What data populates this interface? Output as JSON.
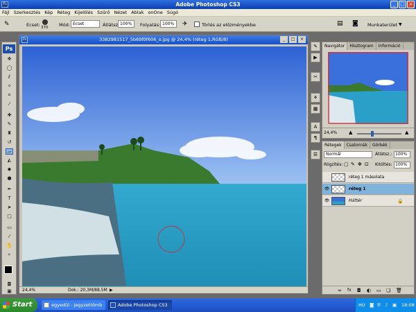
{
  "titlebar": {
    "title": "Adobe Photoshop CS3",
    "app_badge": "Ps"
  },
  "menu": [
    "Fájl",
    "Szerkesztés",
    "Kép",
    "Réteg",
    "Kijelölés",
    "Szűrő",
    "Nézet",
    "Ablak",
    "onOne",
    "Súgó"
  ],
  "options": {
    "brush_label": "Ecset:",
    "brush_size": "370",
    "mode_label": "Mód:",
    "mode_value": "Ecset",
    "opacity_label": "Átlátsz.:",
    "opacity_value": "100%",
    "flow_label": "Folyatás:",
    "flow_value": "100%",
    "erase_history_label": "Törlés az előzményekbe",
    "workspace_label": "Munkaterület"
  },
  "toolbox": {
    "logo": "Ps"
  },
  "document": {
    "title": "3382981517_5b69f0f606_o.jpg @ 24,4% (réteg 1,RGB/8)",
    "zoom": "24,4%",
    "doc_size": "Dok.: 20,3M/88,5M",
    "app_badge": "Ps"
  },
  "navigator": {
    "tabs": [
      "Navigátor",
      "Hisztogram",
      "Információ"
    ],
    "zoom": "24,4%"
  },
  "layers": {
    "tabs": [
      "Rétegek",
      "Csatornák",
      "Görbék"
    ],
    "blend_mode": "Normál",
    "opacity_label": "Átlátsz.:",
    "opacity_value": "100%",
    "lock_label": "Rögzítés:",
    "fill_label": "Kitöltés:",
    "fill_value": "100%",
    "items": [
      {
        "name": "réteg 1 másolata",
        "visible": false,
        "selected": false
      },
      {
        "name": "réteg 1",
        "visible": true,
        "selected": true
      },
      {
        "name": "Háttér",
        "visible": true,
        "selected": false
      }
    ]
  },
  "taskbar": {
    "start": "Start",
    "tasks": [
      "egyedül - Jegyzettömb",
      "Adobe Photoshop CS3"
    ],
    "lang": "HU",
    "clock": "18:08"
  },
  "colors": {
    "accent": "#245dd7",
    "selected_layer": "#7fb3dc"
  }
}
